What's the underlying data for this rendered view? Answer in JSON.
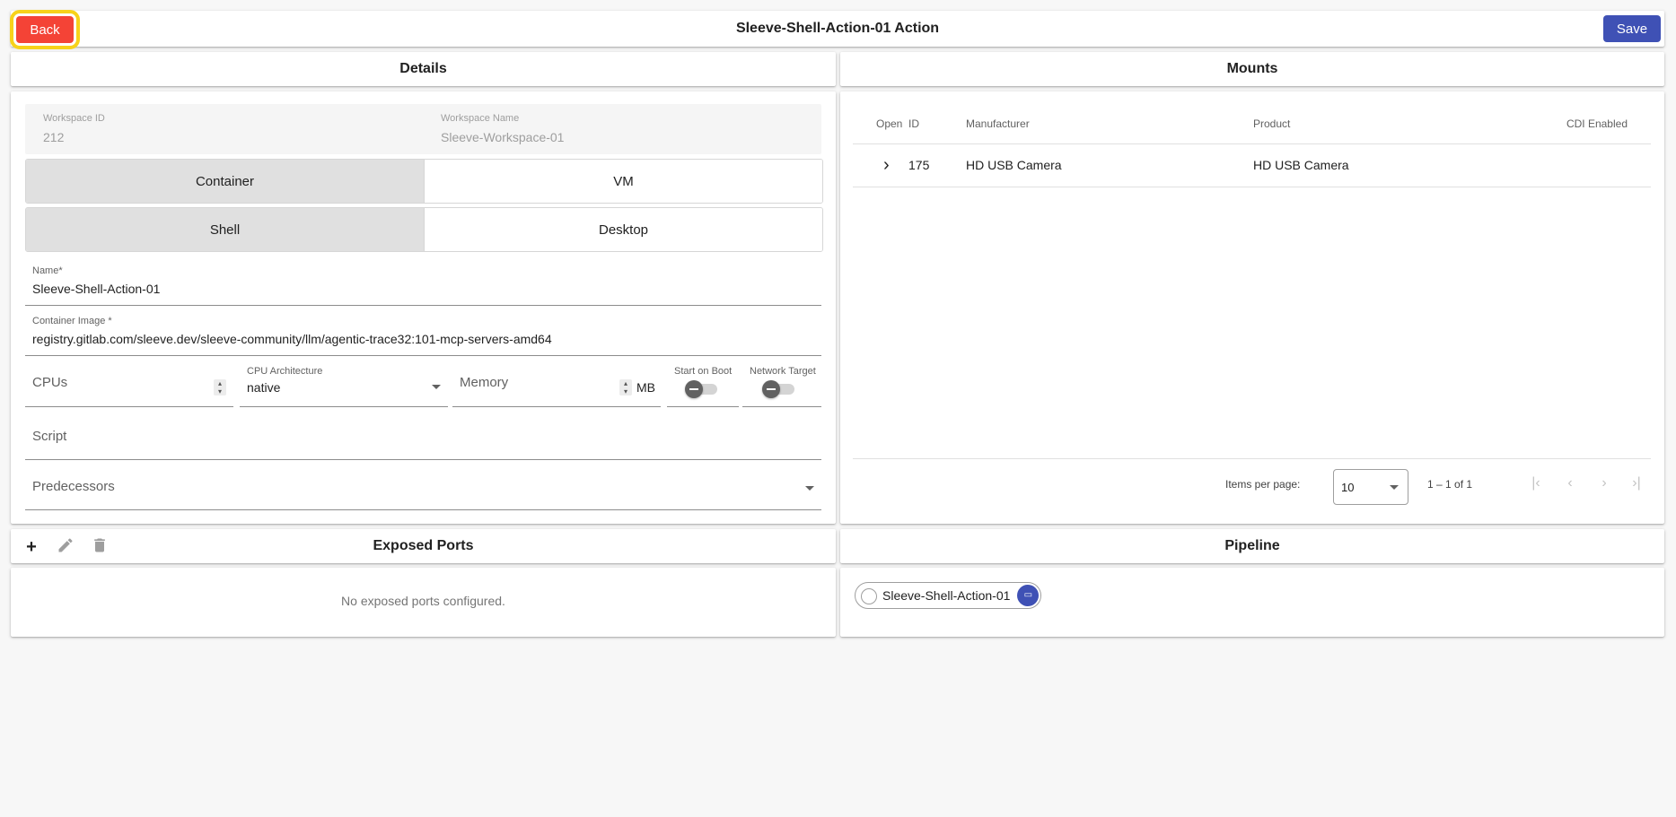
{
  "toolbar": {
    "back_label": "Back",
    "title": "Sleeve-Shell-Action-01 Action",
    "save_label": "Save"
  },
  "details": {
    "header": "Details",
    "workspace_id_label": "Workspace ID",
    "workspace_id": "212",
    "workspace_name_label": "Workspace Name",
    "workspace_name": "Sleeve-Workspace-01",
    "runtime_options": [
      "Container",
      "VM"
    ],
    "runtime_selected": "Container",
    "mode_options": [
      "Shell",
      "Desktop"
    ],
    "mode_selected": "Shell",
    "name_label": "Name*",
    "name_value": "Sleeve-Shell-Action-01",
    "image_label": "Container Image *",
    "image_value": "registry.gitlab.com/sleeve.dev/sleeve-community/llm/agentic-trace32:101-mcp-servers-amd64",
    "cpus_placeholder": "CPUs",
    "cpu_arch_label": "CPU Architecture",
    "cpu_arch_value": "native",
    "memory_placeholder": "Memory",
    "memory_unit": "MB",
    "start_on_boot_label": "Start on Boot",
    "network_target_label": "Network Target",
    "script_placeholder": "Script",
    "predecessors_placeholder": "Predecessors"
  },
  "mounts": {
    "header": "Mounts",
    "columns": [
      "Open",
      "ID",
      "Manufacturer",
      "Product",
      "CDI Enabled"
    ],
    "rows": [
      {
        "open": "›",
        "id": "175",
        "manufacturer": "HD USB Camera",
        "product": "HD USB Camera",
        "cdi_enabled": ""
      }
    ],
    "items_per_page_label": "Items per page:",
    "items_per_page": "10",
    "range": "1 – 1 of 1"
  },
  "ports": {
    "header": "Exposed Ports",
    "empty_message": "No exposed ports configured."
  },
  "pipeline": {
    "header": "Pipeline",
    "chip_label": "Sleeve-Shell-Action-01"
  },
  "colors": {
    "back": "#f44336",
    "save": "#3f51b5",
    "highlight": "#f7d21a"
  }
}
